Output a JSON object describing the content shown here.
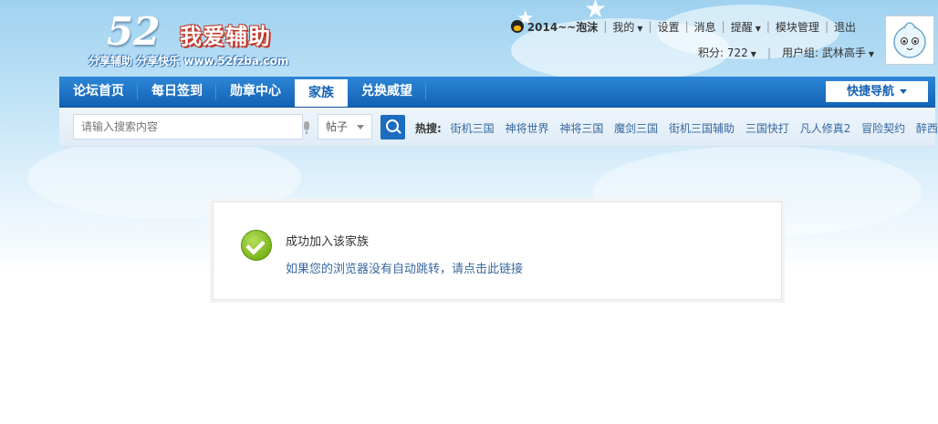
{
  "header": {
    "logo": {
      "number": "52",
      "name": "我爱辅助",
      "slogan": "分享辅助 分享快乐 www.52fzba.com"
    },
    "user": {
      "username": "2014~~泡沫",
      "links": [
        "我的",
        "设置",
        "消息",
        "提醒",
        "模块管理",
        "退出"
      ],
      "points_label": "积分: 722",
      "group_label": "用户组: 武林高手"
    }
  },
  "nav": {
    "items": [
      "论坛首页",
      "每日签到",
      "勋章中心",
      "家族",
      "兑换威望"
    ],
    "active_index": 3,
    "quick_nav_label": "快捷导航"
  },
  "search": {
    "placeholder": "请输入搜索内容",
    "type_label": "帖子",
    "hot_label": "热搜:",
    "hot_terms": [
      "街机三国",
      "神将世界",
      "神将三国",
      "魔剑三国",
      "街机三国辅助",
      "三国快打",
      "凡人修真2",
      "冒险契约",
      "醉西游"
    ]
  },
  "message": {
    "title": "成功加入该家族",
    "link_text": "如果您的浏览器没有自动跳转，请点击此链接"
  },
  "colors": {
    "nav_bg": "#1c6cc0",
    "link": "#36689f",
    "success": "#7ab51c"
  }
}
